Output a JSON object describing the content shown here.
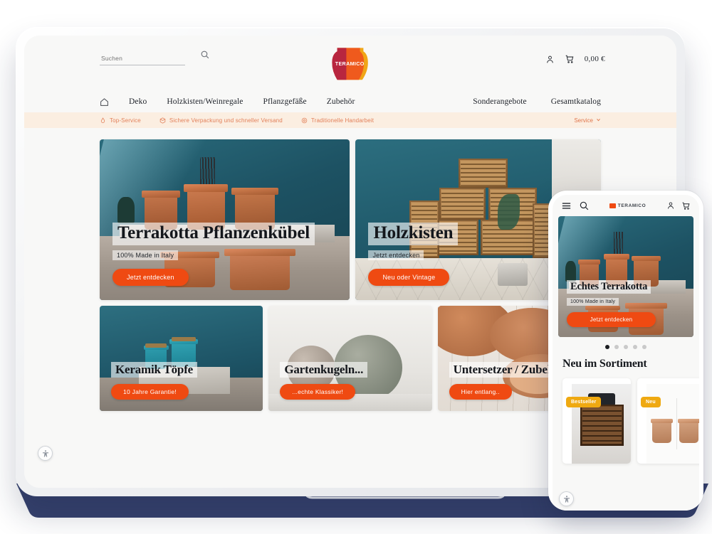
{
  "brand": {
    "name": "TERAMICO",
    "accent": "#ef4a12",
    "badge_color": "#efa911",
    "usp_bar_bg": "#fbeee1",
    "usp_text_color": "#e2805a"
  },
  "desktop": {
    "search": {
      "placeholder": "Suchen",
      "value": "",
      "icon": "search-icon"
    },
    "header_actions": {
      "account_icon": "user-icon",
      "cart_icon": "cart-icon",
      "cart_total": "0,00 €"
    },
    "nav": {
      "home_icon": "home-icon",
      "left_items": [
        "Deko",
        "Holzkisten/Weinregale",
        "Pflanzgefäße",
        "Zubehör"
      ],
      "right_items": [
        "Sonderangebote",
        "Gesamtkatalog"
      ]
    },
    "usp_bar": {
      "items": [
        {
          "icon": "flame-icon",
          "label": "Top-Service"
        },
        {
          "icon": "package-icon",
          "label": "Sichere Verpackung und schneller Versand"
        },
        {
          "icon": "hand-icon",
          "label": "Traditionelle Handarbeit"
        }
      ],
      "service": {
        "label": "Service",
        "icon": "chevron-down-icon"
      }
    },
    "tiles": [
      {
        "id": "terrakotta",
        "title": "Terrakotta Pflanzenkübel",
        "subtitle": "100% Made in Italy",
        "cta": "Jetzt entdecken",
        "scene": "sceneA"
      },
      {
        "id": "holzkisten",
        "title": "Holzkisten",
        "subtitle": "Jetzt entdecken",
        "cta": "Neu oder Vintage",
        "scene": "sceneB"
      },
      {
        "id": "keramik",
        "title": "Keramik Töpfe",
        "subtitle": "",
        "cta": "10 Jahre Garantie!",
        "scene": "sceneC"
      },
      {
        "id": "gartenkugeln",
        "title": "Gartenkugeln...",
        "subtitle": "",
        "cta": "...echte Klassiker!",
        "scene": "sceneD"
      },
      {
        "id": "untersetzer",
        "title": "Untersetzer / Zubehör",
        "subtitle": "",
        "cta": "Hier entlang..",
        "scene": "sceneE"
      }
    ],
    "accessibility_widget": "accessibility-icon"
  },
  "mobile": {
    "header": {
      "menu_icon": "hamburger-menu-icon",
      "search_icon": "search-icon",
      "logo": "TERAMICO",
      "account_icon": "user-icon",
      "cart_icon": "cart-icon"
    },
    "hero": {
      "title": "Echtes Terrakotta",
      "subtitle": "100% Made in Italy",
      "cta": "Jetzt entdecken"
    },
    "carousel": {
      "total_dots": 5,
      "active_index": 0
    },
    "section_title": "Neu im Sortiment",
    "products": [
      {
        "badge": "Bestseller",
        "media": "wooden-crate-photo"
      },
      {
        "badge": "Neu",
        "media": "terracotta-pots-photo"
      }
    ],
    "accessibility_widget": "accessibility-icon"
  }
}
